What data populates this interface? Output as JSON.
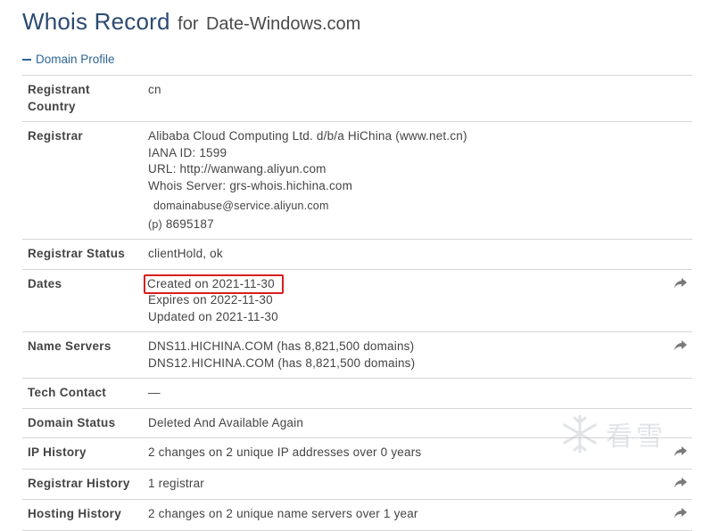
{
  "header": {
    "title": "Whois Record",
    "subtitle_prefix": "for",
    "domain": "Date-Windows.com"
  },
  "section": {
    "label": "Domain Profile",
    "toggle_icon": "minus-icon"
  },
  "rows": {
    "registrant_country": {
      "label": "Registrant Country",
      "value": "cn"
    },
    "registrar": {
      "label": "Registrar",
      "lines": [
        "Alibaba Cloud Computing Ltd. d/b/a HiChina (www.net.cn)",
        "IANA ID: 1599",
        "URL: http://wanwang.aliyun.com",
        "Whois Server: grs-whois.hichina.com"
      ],
      "email": "domainabuse@service.aliyun.com",
      "phone_prefix": "(p)",
      "phone": "8695187"
    },
    "registrar_status": {
      "label": "Registrar Status",
      "value": "clientHold, ok"
    },
    "dates": {
      "label": "Dates",
      "created": "Created on 2021-11-30",
      "expires": "Expires on 2022-11-30",
      "updated": "Updated on 2021-11-30"
    },
    "name_servers": {
      "label": "Name Servers",
      "ns1": "DNS11.HICHINA.COM (has 8,821,500 domains)",
      "ns2": "DNS12.HICHINA.COM (has 8,821,500 domains)"
    },
    "tech_contact": {
      "label": "Tech Contact",
      "value": "—"
    },
    "domain_status": {
      "label": "Domain Status",
      "value": "Deleted And Available Again"
    },
    "ip_history": {
      "label": "IP History",
      "value": "2 changes on 2 unique IP addresses over 0 years"
    },
    "registrar_history": {
      "label": "Registrar History",
      "value": "1 registrar"
    },
    "hosting_history": {
      "label": "Hosting History",
      "value": "2 changes on 2 unique name servers over 1 year"
    }
  },
  "icons": {
    "share": "share-arrow-icon",
    "watermark_logo": "snowflake-logo-icon"
  },
  "colors": {
    "title": "#2c4a72",
    "link": "#2d6596",
    "highlight_border": "#d81f1f"
  },
  "watermark": {
    "text": "看雪"
  }
}
